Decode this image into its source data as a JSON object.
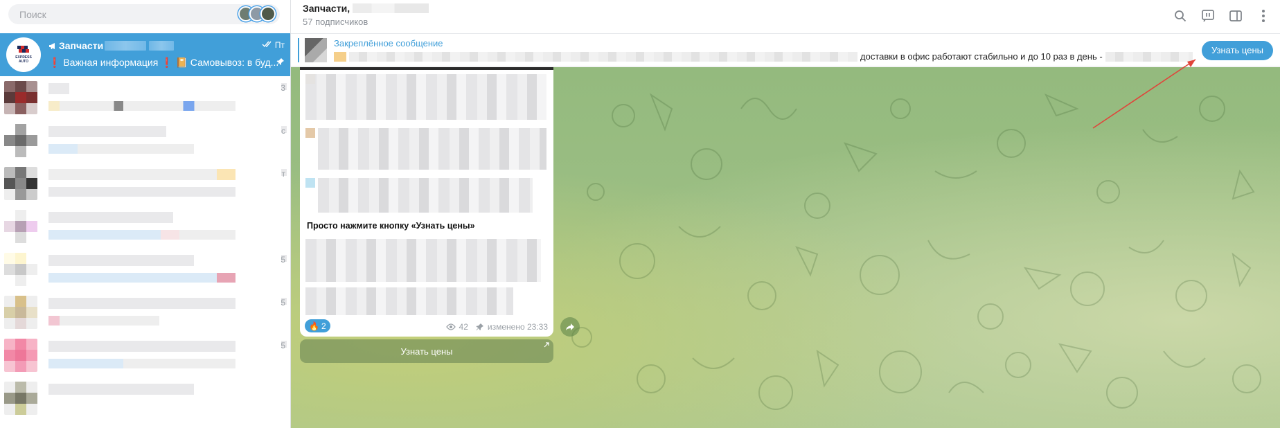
{
  "search": {
    "placeholder": "Поиск"
  },
  "active_chat": {
    "title": "Запчасти",
    "date": "Пт",
    "preview": "❗ Важная информация ❗ 📔 Самовывоз: в буд...",
    "logo_text_1": "EXPRESS",
    "logo_text_2": "AUTO"
  },
  "chat_list_side_letters": [
    "3",
    "с",
    "т",
    "",
    "5",
    "5",
    "5",
    ""
  ],
  "header": {
    "title": "Запчасти",
    "subscribers": "57 подписчиков",
    "icons": [
      "search-icon",
      "live-stream-icon",
      "sidebar-toggle-icon",
      "more-icon"
    ]
  },
  "pinned": {
    "label": "Закреплённое сообщение",
    "text": "доставки в офис работают стабильно и до 10 раз в день -",
    "button": "Узнать цены"
  },
  "message": {
    "bold_line": "Просто нажмите кнопку «Узнать цены»",
    "reaction_emoji": "🔥",
    "reaction_count": "2",
    "views": "42",
    "edited": "изменено 23:33",
    "inline_button": "Узнать цены"
  },
  "colors": {
    "accent": "#419fd9",
    "annotation_arrow": "#e0443a"
  }
}
